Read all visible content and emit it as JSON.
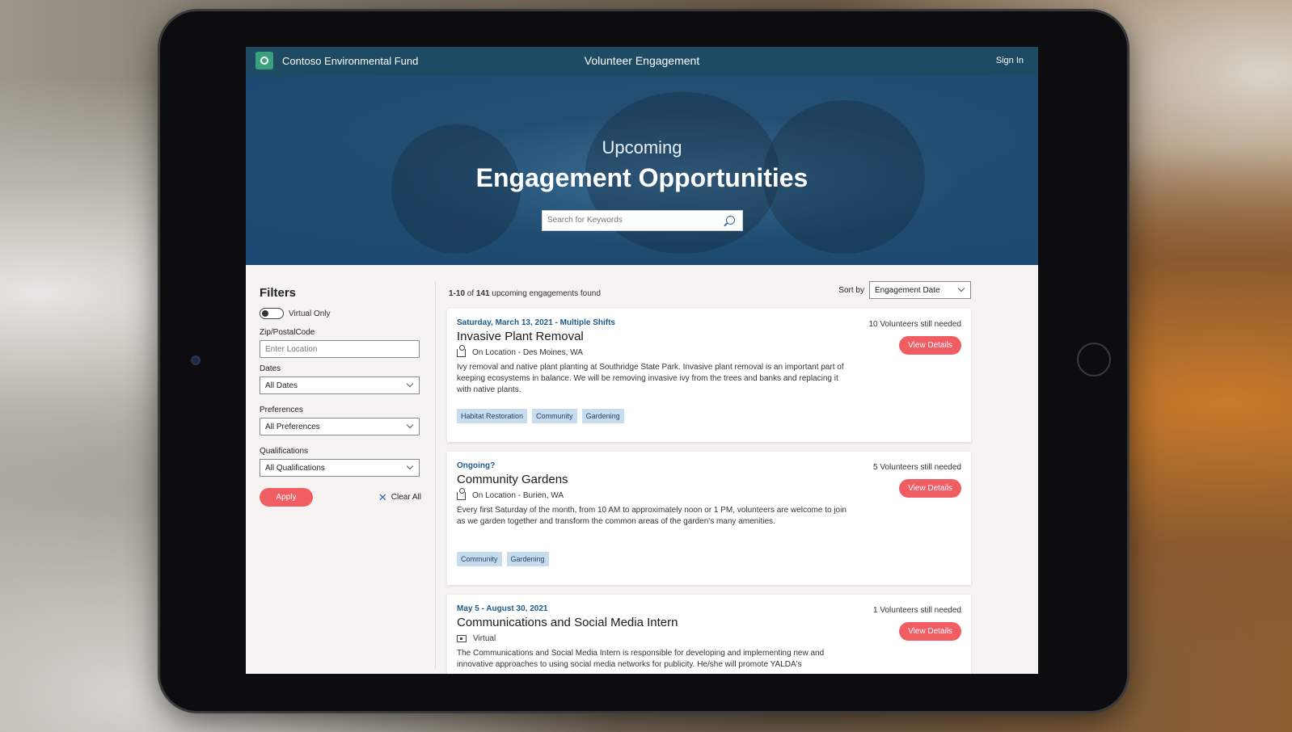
{
  "header": {
    "org_name": "Contoso Environmental Fund",
    "app_title": "Volunteer Engagement",
    "signin": "Sign In",
    "logo_icon": "tree-icon"
  },
  "hero": {
    "subtitle": "Upcoming",
    "title": "Engagement Opportunities",
    "search_placeholder": "Search for Keywords"
  },
  "filters": {
    "heading": "Filters",
    "virtual_only": "Virtual Only",
    "zip_label": "Zip/PostalCode",
    "zip_placeholder": "Enter Location",
    "dates_label": "Dates",
    "dates_value": "All Dates",
    "preferences_label": "Preferences",
    "preferences_value": "All Preferences",
    "qualifications_label": "Qualifications",
    "qualifications_value": "All Qualifications",
    "apply": "Apply",
    "clear_all": "Clear All"
  },
  "results": {
    "range": "1-10",
    "of": "of",
    "total": "141",
    "suffix": "upcoming engagements found",
    "sort_label": "Sort by",
    "sort_value": "Engagement Date",
    "cards": [
      {
        "date": "Saturday, March 13, 2021 - Multiple Shifts",
        "title": "Invasive Plant Removal",
        "location": "On Location - Des Moines, WA",
        "description": "Ivy removal and native plant planting at Southridge State Park. Invasive plant removal is an important part of keeping ecosystems in balance. We will be removing invasive ivy from the trees and banks and replacing it with native plants.",
        "needed": "10 Volunteers still needed",
        "button": "View Details",
        "tags": [
          "Habitat Restoration",
          "Community",
          "Gardening"
        ]
      },
      {
        "date": "Ongoing?",
        "title": "Community Gardens",
        "location": "On Location - Burien, WA",
        "description": "Every first Saturday of the month, from 10 AM to approximately noon or 1 PM, volunteers are welcome to join as we garden together and transform the common areas of the garden's many amenities.",
        "needed": "5 Volunteers still needed",
        "button": "View Details",
        "tags": [
          "Community",
          "Gardening"
        ]
      },
      {
        "date": "May 5 - August 30, 2021",
        "title": "Communications and Social Media Intern",
        "location": "Virtual",
        "description": "The Communications and Social Media Intern is responsible for developing and implementing new and innovative approaches to using social media networks for publicity. He/she will promote YALDA's",
        "needed": "1 Volunteers still needed",
        "button": "View Details",
        "tags": []
      }
    ]
  },
  "colors": {
    "header_bg": "#1e4a64",
    "accent": "#f05d62",
    "tag_bg": "#c8dcef",
    "date_text": "#1e5a8a"
  }
}
